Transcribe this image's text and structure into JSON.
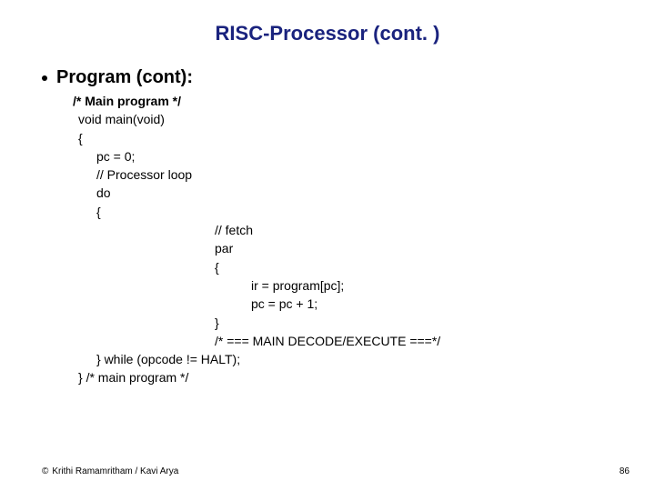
{
  "title": "RISC-Processor (cont. )",
  "bullet": "Program (cont):",
  "code": {
    "l0": "/* Main program */",
    "l1": "void main(void)",
    "l2": "{",
    "l3": "pc = 0;",
    "l4": "// Processor loop",
    "l5": "do",
    "l6": "{",
    "l7": "// fetch",
    "l8": "par",
    "l9": "{",
    "l10": "ir = program[pc];",
    "l11": "pc = pc + 1;",
    "l12": "}",
    "l13": "/* === MAIN DECODE/EXECUTE ===*/",
    "l14": "} while (opcode != HALT);",
    "l15": "} /* main program */"
  },
  "footer": {
    "copyright_symbol": "©",
    "authors": "Krithi Ramamritham / Kavi Arya",
    "page_number": "86"
  }
}
